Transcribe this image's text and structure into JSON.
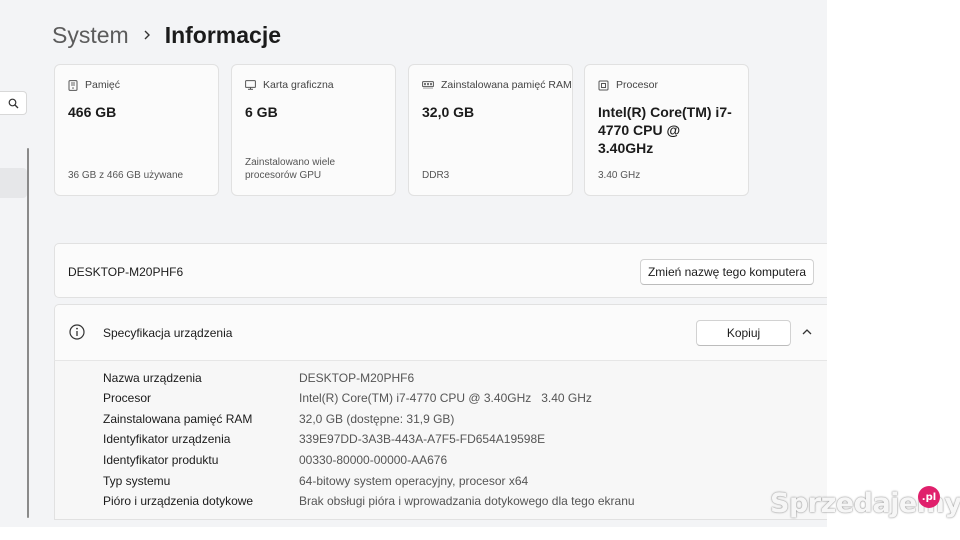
{
  "breadcrumb": {
    "parent": "System",
    "current": "Informacje"
  },
  "cards": [
    {
      "icon": "storage-icon",
      "label": "Pamięć",
      "value": "466 GB",
      "sub": "36 GB z 466 GB używane"
    },
    {
      "icon": "graphics-card-icon",
      "label": "Karta graficzna",
      "value": "6 GB",
      "sub": "Zainstalowano wiele procesorów GPU"
    },
    {
      "icon": "ram-icon",
      "label": "Zainstalowana pamięć RAM",
      "value": "32,0 GB",
      "sub": "DDR3"
    },
    {
      "icon": "processor-icon",
      "label": "Procesor",
      "value": "Intel(R) Core(TM) i7-4770 CPU @ 3.40GHz",
      "sub": "3.40 GHz"
    }
  ],
  "device": {
    "name": "DESKTOP-M20PHF6",
    "rename_label": "Zmień nazwę tego komputera"
  },
  "spec": {
    "title": "Specyfikacja urządzenia",
    "copy_label": "Kopiuj",
    "rows": [
      {
        "label": "Nazwa urządzenia",
        "value": "DESKTOP-M20PHF6"
      },
      {
        "label": "Procesor",
        "value": "Intel(R) Core(TM) i7-4770 CPU @ 3.40GHz   3.40 GHz"
      },
      {
        "label": "Zainstalowana pamięć RAM",
        "value": "32,0 GB (dostępne: 31,9 GB)"
      },
      {
        "label": "Identyfikator urządzenia",
        "value": "339E97DD-3A3B-443A-A7F5-FD654A19598E"
      },
      {
        "label": "Identyfikator produktu",
        "value": "00330-80000-00000-AA676"
      },
      {
        "label": "Typ systemu",
        "value": "64-bitowy system operacyjny, procesor x64"
      },
      {
        "label": "Pióro i urządzenia dotykowe",
        "value": "Brak obsługi pióra i wprowadzania dotykowego dla tego ekranu"
      }
    ]
  },
  "watermark": {
    "text": "Sprzedajemy",
    "badge": ".pl"
  },
  "colors": {
    "background": "#f3f4f6",
    "card": "#fbfbfb",
    "border": "#e1e1e1",
    "badge": "#e0206c"
  }
}
